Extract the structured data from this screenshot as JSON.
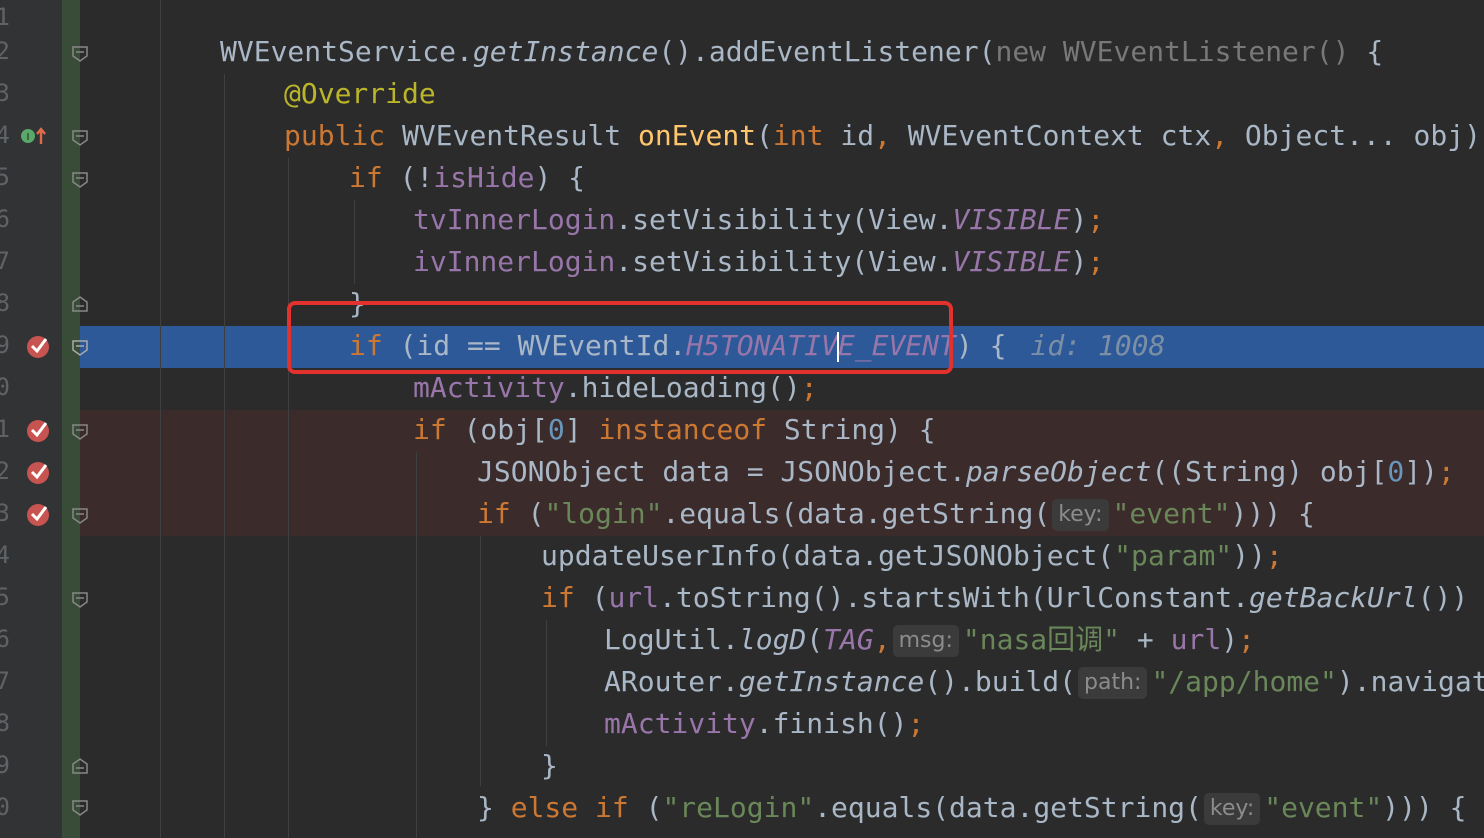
{
  "editor": {
    "line_numbers": [
      "1",
      "2",
      "3",
      "4",
      "5",
      "6",
      "7",
      "8",
      "9",
      "0",
      "1",
      "2",
      "3",
      "4",
      "5",
      "6",
      "7",
      "8",
      "9",
      "0"
    ],
    "lines": {
      "l2": {
        "cls": "WVEventService",
        "dot1": ".",
        "m1": "getInstance",
        "p1": "().addEventListener(",
        "new_kw": "new",
        "cls2": " WVEventListener() ",
        "brace": "{"
      },
      "l3": {
        "ann": "@Override"
      },
      "l4": {
        "kw_public": "public",
        "t1": " WVEventResult ",
        "fn": "onEvent",
        "p1": "(",
        "kw_int": "int",
        "t2": " id",
        "comma1": ",",
        "t3": " WVEventContext ctx",
        "comma2": ",",
        "t4": " Object... obj) {"
      },
      "l5": {
        "kw_if": "if",
        "t1": " (!",
        "field": "isHide",
        "t2": ") {"
      },
      "l6": {
        "field": "tvInnerLogin",
        "t1": ".setVisibility(View.",
        "sfield": "VISIBLE",
        "t2": ")",
        "semi": ";"
      },
      "l7": {
        "field": "ivInnerLogin",
        "t1": ".setVisibility(View.",
        "sfield": "VISIBLE",
        "t2": ")",
        "semi": ";"
      },
      "l8": {
        "t1": "}"
      },
      "l9": {
        "kw_if": "if",
        "t1": " (id == WVEventId.",
        "sfield_a": "H5TONATIV",
        "sfield_b": "E_EVENT",
        "t2": ") {",
        "debug": "id: 1008"
      },
      "l10": {
        "field": "mActivity",
        "t1": ".hideLoading()",
        "semi": ";"
      },
      "l11": {
        "kw_if": "if",
        "t1": " (obj[",
        "num": "0",
        "t2": "] ",
        "kw_inst": "instanceof",
        "t3": " String) {"
      },
      "l12": {
        "t1": "JSONObject data = JSONObject.",
        "sm": "parseObject",
        "t2": "((String) obj[",
        "num": "0",
        "t3": "])",
        "semi": ";"
      },
      "l13": {
        "kw_if": "if",
        "t1": " (",
        "str1": "\"login\"",
        "t2": ".equals(data.getString(",
        "hint": "key:",
        "str2": "\"event\"",
        "t3": "))) {"
      },
      "l14": {
        "t1": "updateUserInfo(data.getJSONObject(",
        "str": "\"param\"",
        "t2": "))",
        "semi": ";"
      },
      "l15": {
        "kw_if": "if",
        "t1": " (",
        "field": "url",
        "t2": ".toString().startsWith(UrlConstant.",
        "sm": "getBackUrl",
        "t3": "()) &&"
      },
      "l16": {
        "t1": "LogUtil.",
        "sm": "logD",
        "t2": "(",
        "sfield": "TAG",
        "comma": ",",
        "hint": "msg:",
        "str": "\"nasa回调\"",
        "t3": " + ",
        "field": "url",
        "t4": ")",
        "semi": ";"
      },
      "l17": {
        "t1": "ARouter.",
        "sm": "getInstance",
        "t2": "().build(",
        "hint": "path:",
        "str": "\"/app/home\"",
        "t3": ").navigati"
      },
      "l18": {
        "field": "mActivity",
        "t1": ".finish()",
        "semi": ";"
      },
      "l19": {
        "t1": "}"
      },
      "l20": {
        "t1": "} ",
        "kw_else": "else",
        "sp": " ",
        "kw_if": "if",
        "t2": " (",
        "str1": "\"reLogin\"",
        "t3": ".equals(data.getString(",
        "hint": "key:",
        "str2": "\"event\"",
        "t4": "))) {"
      }
    }
  },
  "icons": {
    "breakpoint": "breakpoint-check-icon",
    "implements": "implements-method-icon",
    "fold": "fold-marker-icon"
  },
  "colors": {
    "background": "#2b2b2b",
    "current_line": "#2d5999",
    "breakpoint_line": "#3b2b2b",
    "keyword": "#cc7832",
    "string": "#6a8759",
    "field": "#9876aa",
    "highlight_box": "#e3322e"
  }
}
